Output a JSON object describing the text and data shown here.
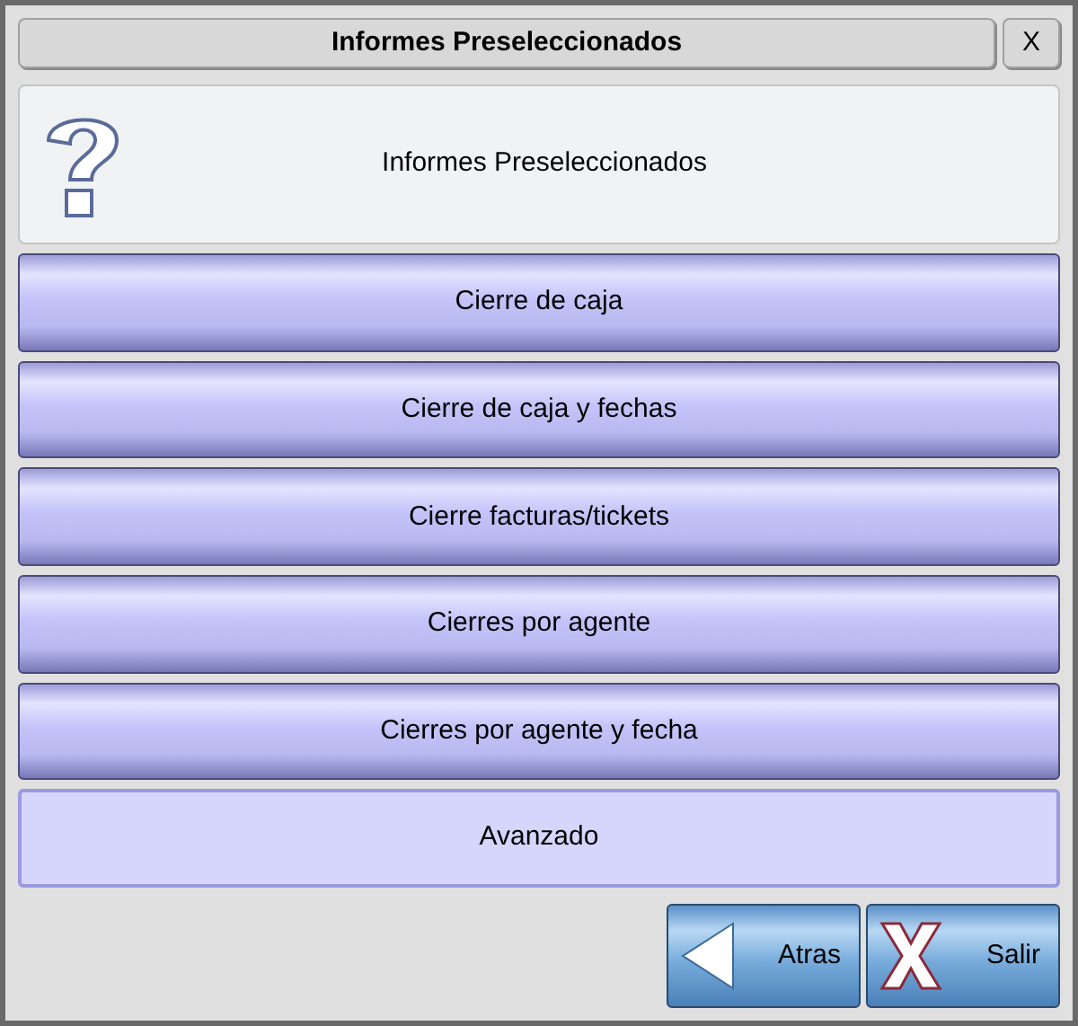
{
  "window": {
    "title": "Informes Preseleccionados",
    "close": "X"
  },
  "header": {
    "text": "Informes Preseleccionados"
  },
  "options": [
    {
      "label": "Cierre de caja",
      "kind": "glossy"
    },
    {
      "label": "Cierre de caja y fechas",
      "kind": "glossy"
    },
    {
      "label": "Cierre facturas/tickets",
      "kind": "glossy"
    },
    {
      "label": "Cierres por agente",
      "kind": "glossy"
    },
    {
      "label": "Cierres por agente y fecha",
      "kind": "glossy"
    },
    {
      "label": "Avanzado",
      "kind": "flat"
    }
  ],
  "actions": [
    {
      "label": "Atras",
      "kind": "back"
    },
    {
      "label": "Salir",
      "kind": "exit"
    }
  ]
}
